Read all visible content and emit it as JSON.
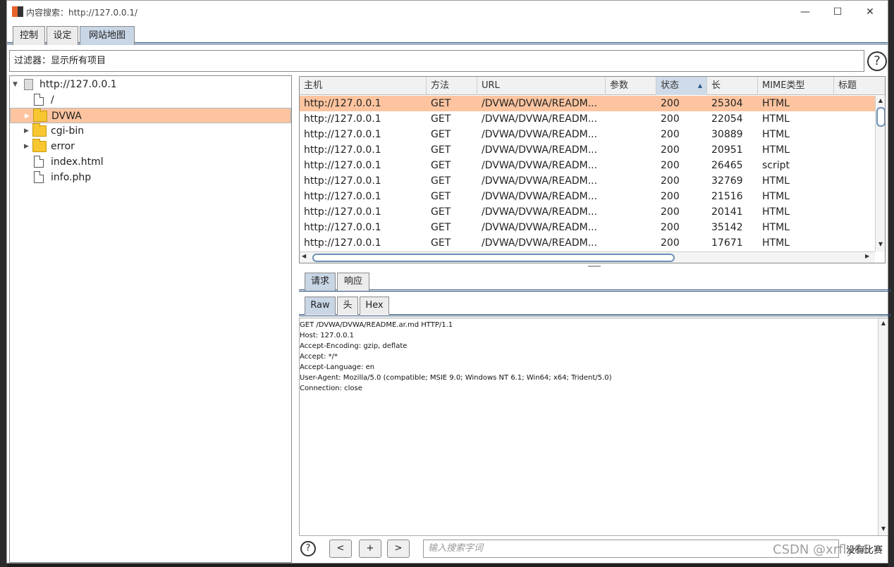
{
  "window": {
    "title": "内容搜索：http://127.0.0.1/",
    "controls": {
      "minimize": "—",
      "maximize": "☐",
      "close": "✕"
    }
  },
  "tabs": [
    {
      "label": "控制"
    },
    {
      "label": "设定"
    },
    {
      "label": "网站地图"
    }
  ],
  "filter": {
    "label": "过滤器：显示所有项目"
  },
  "tree": {
    "items": [
      {
        "label": "http://127.0.0.1",
        "kind": "host",
        "toggle": "▼",
        "level": 0
      },
      {
        "label": "/",
        "kind": "file",
        "toggle": "",
        "level": 1
      },
      {
        "label": "DVWA",
        "kind": "folder",
        "toggle": "▶",
        "level": 1,
        "selected": true
      },
      {
        "label": "cgi-bin",
        "kind": "folder",
        "toggle": "▶",
        "level": 1
      },
      {
        "label": "error",
        "kind": "folder",
        "toggle": "▶",
        "level": 1
      },
      {
        "label": "index.html",
        "kind": "file",
        "toggle": "",
        "level": 1
      },
      {
        "label": "info.php",
        "kind": "file",
        "toggle": "",
        "level": 1
      }
    ]
  },
  "table": {
    "columns": [
      "主机",
      "方法",
      "URL",
      "参数",
      "状态",
      "长",
      "MIME类型",
      "标题"
    ],
    "sort_indicator": "▲",
    "rows": [
      {
        "host": "http://127.0.0.1",
        "method": "GET",
        "url": "/DVWA/DVWA/READM...",
        "params": "",
        "status": "200",
        "length": "25304",
        "mime": "HTML",
        "title": ""
      },
      {
        "host": "http://127.0.0.1",
        "method": "GET",
        "url": "/DVWA/DVWA/READM...",
        "params": "",
        "status": "200",
        "length": "22054",
        "mime": "HTML",
        "title": ""
      },
      {
        "host": "http://127.0.0.1",
        "method": "GET",
        "url": "/DVWA/DVWA/READM...",
        "params": "",
        "status": "200",
        "length": "30889",
        "mime": "HTML",
        "title": ""
      },
      {
        "host": "http://127.0.0.1",
        "method": "GET",
        "url": "/DVWA/DVWA/READM...",
        "params": "",
        "status": "200",
        "length": "20951",
        "mime": "HTML",
        "title": ""
      },
      {
        "host": "http://127.0.0.1",
        "method": "GET",
        "url": "/DVWA/DVWA/READM...",
        "params": "",
        "status": "200",
        "length": "26465",
        "mime": "script",
        "title": ""
      },
      {
        "host": "http://127.0.0.1",
        "method": "GET",
        "url": "/DVWA/DVWA/READM...",
        "params": "",
        "status": "200",
        "length": "32769",
        "mime": "HTML",
        "title": ""
      },
      {
        "host": "http://127.0.0.1",
        "method": "GET",
        "url": "/DVWA/DVWA/READM...",
        "params": "",
        "status": "200",
        "length": "21516",
        "mime": "HTML",
        "title": ""
      },
      {
        "host": "http://127.0.0.1",
        "method": "GET",
        "url": "/DVWA/DVWA/READM...",
        "params": "",
        "status": "200",
        "length": "20141",
        "mime": "HTML",
        "title": ""
      },
      {
        "host": "http://127.0.0.1",
        "method": "GET",
        "url": "/DVWA/DVWA/READM...",
        "params": "",
        "status": "200",
        "length": "35142",
        "mime": "HTML",
        "title": ""
      },
      {
        "host": "http://127.0.0.1",
        "method": "GET",
        "url": "/DVWA/DVWA/READM...",
        "params": "",
        "status": "200",
        "length": "17671",
        "mime": "HTML",
        "title": ""
      }
    ],
    "selected_row": 0,
    "scroll_arrows": {
      "up": "▲",
      "down": "▼",
      "left": "◀",
      "right": "▶"
    }
  },
  "message_tabs": [
    {
      "label": "请求"
    },
    {
      "label": "响应"
    }
  ],
  "view_tabs": [
    {
      "label": "Raw"
    },
    {
      "label": "头"
    },
    {
      "label": "Hex"
    }
  ],
  "request": {
    "lines": [
      "GET /DVWA/DVWA/README.ar.md HTTP/1.1",
      "Host: 127.0.0.1",
      "Accept-Encoding: gzip, deflate",
      "Accept: */*",
      "Accept-Language: en",
      "User-Agent: Mozilla/5.0 (compatible; MSIE 9.0; Windows NT 6.1; Win64; x64; Trident/5.0)",
      "Connection: close"
    ]
  },
  "search": {
    "help": "?",
    "prev": "<",
    "add": "+",
    "next": ">",
    "placeholder": "输入搜索字词",
    "match_status": "没有比赛"
  },
  "help_icon": "?",
  "watermark": "CSDN @xrfly66",
  "colors": {
    "selection": "#fdc49f",
    "accent": "#2e4f78",
    "brand": "#e8632b"
  }
}
